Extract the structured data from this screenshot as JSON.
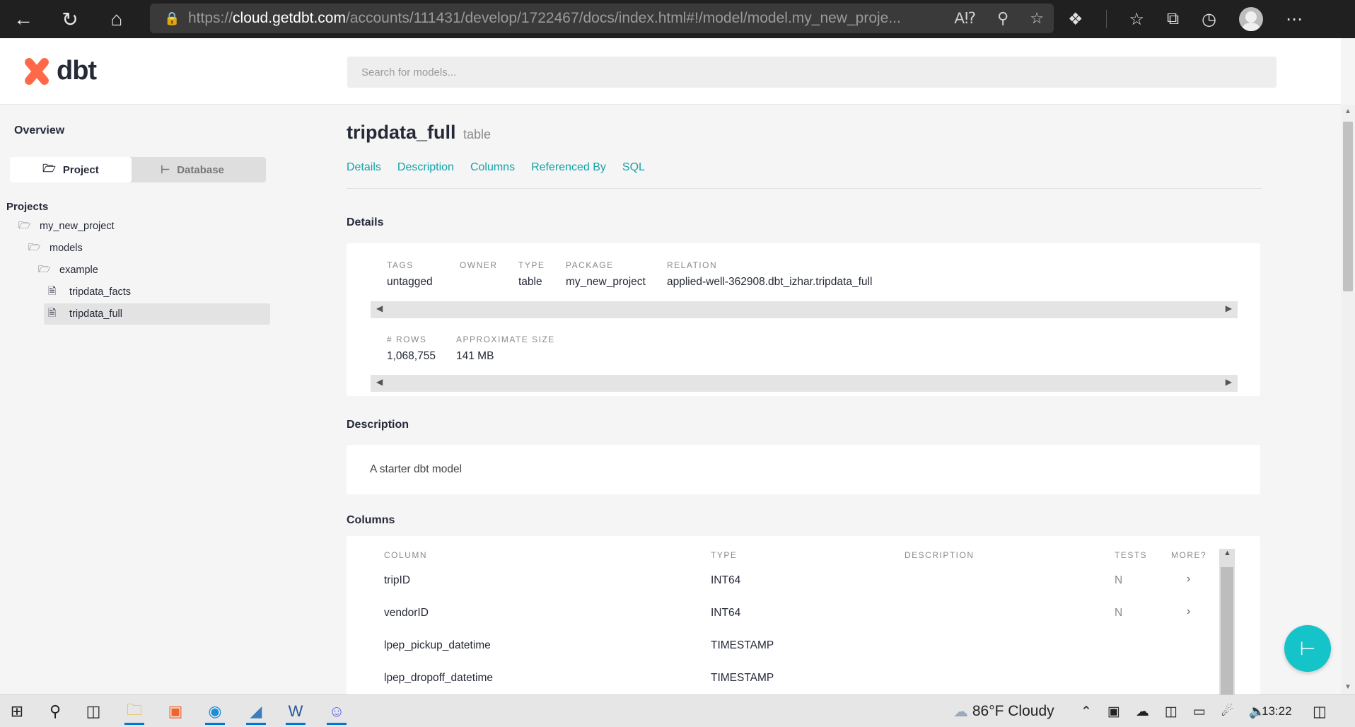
{
  "browser": {
    "url_prefix": "https://",
    "url_host": "cloud.getdbt.com",
    "url_path": "/accounts/111431/develop/1722467/docs/index.html#!/model/model.my_new_proje..."
  },
  "app": {
    "logo_text": "dbt",
    "search_placeholder": "Search for models..."
  },
  "sidebar": {
    "overview": "Overview",
    "tab_project": "Project",
    "tab_database": "Database",
    "projects_label": "Projects",
    "tree": [
      "my_new_project",
      "models",
      "example",
      "tripdata_facts",
      "tripdata_full"
    ]
  },
  "model": {
    "name": "tripdata_full",
    "kind": "table",
    "tabs": [
      "Details",
      "Description",
      "Columns",
      "Referenced By",
      "SQL"
    ]
  },
  "details": {
    "section_title": "Details",
    "labels": {
      "tags": "TAGS",
      "owner": "OWNER",
      "type": "TYPE",
      "package": "PACKAGE",
      "relation": "RELATION",
      "rows": "# ROWS",
      "size": "APPROXIMATE SIZE"
    },
    "values": {
      "tags": "untagged",
      "owner": "",
      "type": "table",
      "package": "my_new_project",
      "relation": "applied-well-362908.dbt_izhar.tripdata_full",
      "rows": "1,068,755",
      "size": "141 MB"
    }
  },
  "description": {
    "section_title": "Description",
    "text": "A starter dbt model"
  },
  "columns": {
    "section_title": "Columns",
    "headers": [
      "COLUMN",
      "TYPE",
      "DESCRIPTION",
      "TESTS",
      "MORE?"
    ],
    "rows": [
      {
        "name": "tripID",
        "type": "INT64",
        "description": "",
        "tests": "N",
        "more": "›"
      },
      {
        "name": "vendorID",
        "type": "INT64",
        "description": "",
        "tests": "N",
        "more": "›"
      },
      {
        "name": "lpep_pickup_datetime",
        "type": "TIMESTAMP",
        "description": "",
        "tests": "",
        "more": ""
      },
      {
        "name": "lpep_dropoff_datetime",
        "type": "TIMESTAMP",
        "description": "",
        "tests": "",
        "more": ""
      }
    ]
  },
  "taskbar": {
    "weather": "86°F  Cloudy",
    "time": "13:22"
  }
}
